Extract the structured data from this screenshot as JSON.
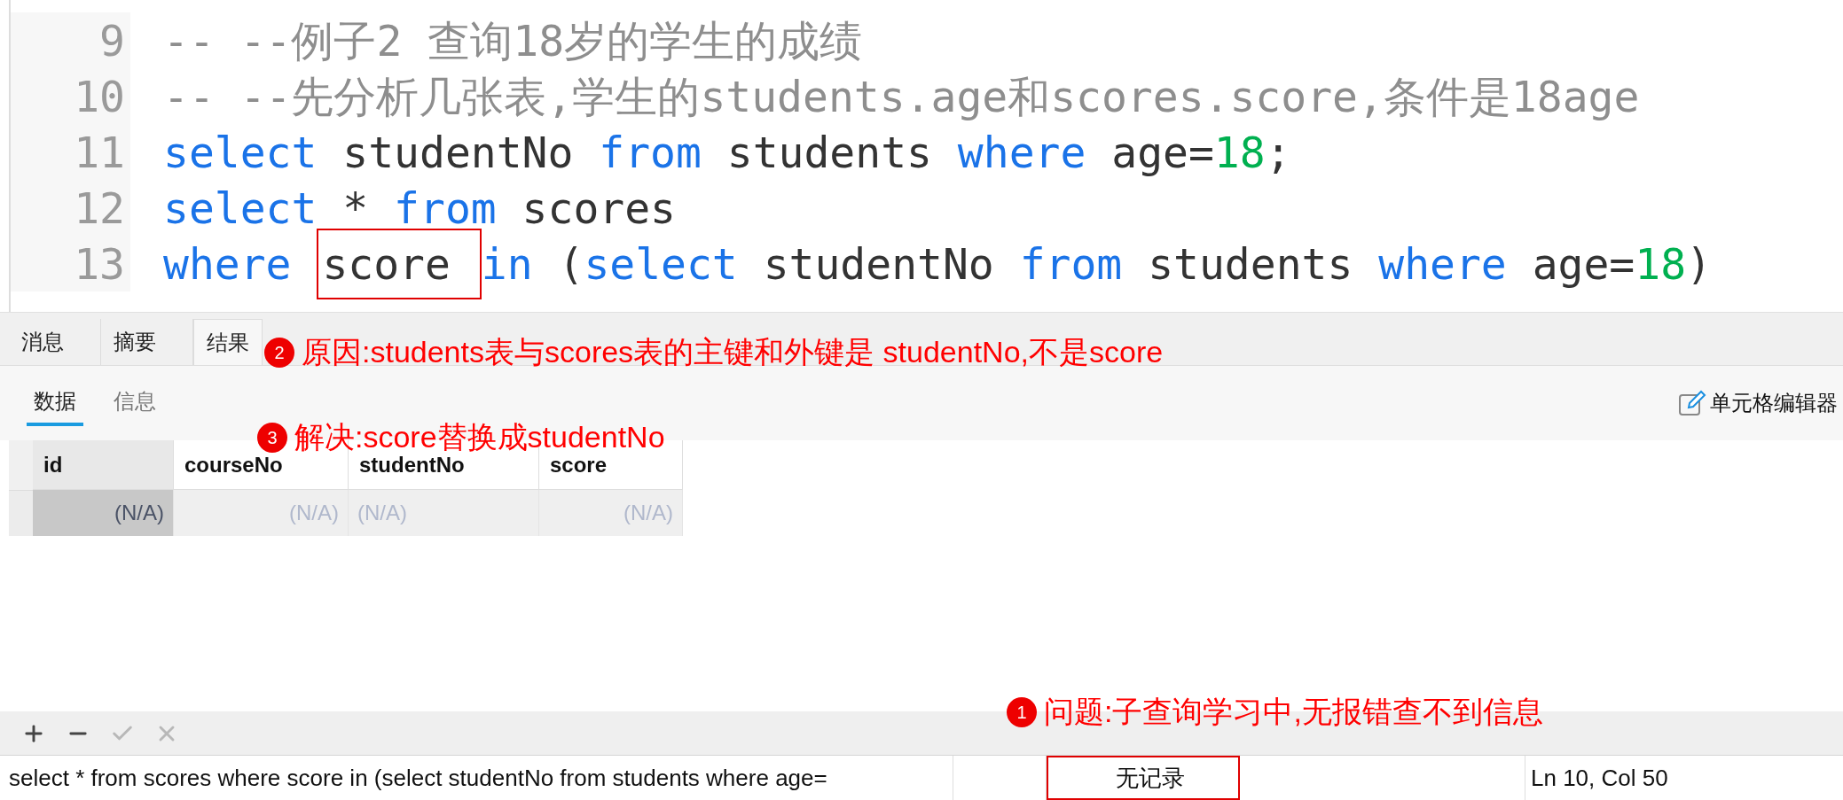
{
  "editor": {
    "lines": [
      {
        "number": "9",
        "tokens": [
          {
            "text": "-- --例子2 查询18岁的学生的成绩",
            "kind": "comment"
          }
        ]
      },
      {
        "number": "10",
        "tokens": [
          {
            "text": "-- --先分析几张表,学生的students.age和scores.score,条件是18age",
            "kind": "comment"
          }
        ]
      },
      {
        "number": "11",
        "tokens": [
          {
            "text": "select",
            "kind": "keyword"
          },
          {
            "text": " studentNo ",
            "kind": "plain"
          },
          {
            "text": "from",
            "kind": "keyword"
          },
          {
            "text": " students ",
            "kind": "plain"
          },
          {
            "text": "where",
            "kind": "keyword"
          },
          {
            "text": " age=",
            "kind": "plain"
          },
          {
            "text": "18",
            "kind": "number"
          },
          {
            "text": ";",
            "kind": "plain"
          }
        ]
      },
      {
        "number": "12",
        "tokens": [
          {
            "text": "select",
            "kind": "keyword"
          },
          {
            "text": " * ",
            "kind": "plain"
          },
          {
            "text": "from",
            "kind": "keyword"
          },
          {
            "text": " scores",
            "kind": "plain"
          }
        ]
      },
      {
        "number": "13",
        "tokens": [
          {
            "text": "where ",
            "kind": "keyword"
          },
          {
            "text": "score ",
            "kind": "marked"
          },
          {
            "text": "in",
            "kind": "keyword"
          },
          {
            "text": " (",
            "kind": "plain"
          },
          {
            "text": "select",
            "kind": "keyword"
          },
          {
            "text": " studentNo ",
            "kind": "plain"
          },
          {
            "text": "from",
            "kind": "keyword"
          },
          {
            "text": " students ",
            "kind": "plain"
          },
          {
            "text": "where",
            "kind": "keyword"
          },
          {
            "text": " age=",
            "kind": "plain"
          },
          {
            "text": "18",
            "kind": "number"
          },
          {
            "text": ")",
            "kind": "plain"
          }
        ]
      }
    ]
  },
  "result_tabs": [
    {
      "label": "消息",
      "selected": false
    },
    {
      "label": "摘要",
      "selected": false
    },
    {
      "label": "结果",
      "selected": true
    }
  ],
  "sub_tabs": [
    {
      "label": "数据",
      "selected": true
    },
    {
      "label": "信息",
      "selected": false
    }
  ],
  "cell_editor_button": "单元格编辑器",
  "table": {
    "columns": [
      {
        "name": "id",
        "kind": "number",
        "selected": true
      },
      {
        "name": "courseNo",
        "kind": "number",
        "selected": false
      },
      {
        "name": "studentNo",
        "kind": "text",
        "selected": false
      },
      {
        "name": "score",
        "kind": "number",
        "selected": false
      }
    ],
    "rows": [
      {
        "cells": [
          {
            "text": "(N/A)",
            "selected": true
          },
          {
            "text": "(N/A)",
            "selected": false
          },
          {
            "text": "(N/A)",
            "selected": false
          },
          {
            "text": "(N/A)",
            "selected": false
          }
        ]
      }
    ]
  },
  "grid_actions": [
    {
      "kind": "add",
      "disabled": false
    },
    {
      "kind": "remove",
      "disabled": false
    },
    {
      "kind": "apply",
      "disabled": true
    },
    {
      "kind": "cancel",
      "disabled": true
    }
  ],
  "status_bar": {
    "query": "select * from scores where score in (select studentNo from students where age=",
    "record_status": {
      "text": "无记录",
      "boxed": true
    },
    "position": "Ln 10, Col 50"
  },
  "annotations": [
    {
      "number": "2",
      "text": "原因:students表与scores表的主键和外键是 studentNo,不是score"
    },
    {
      "number": "3",
      "text": "解决:score替换成studentNo"
    },
    {
      "number": "1",
      "text": "问题:子查询学习中,无报错查不到信息"
    }
  ]
}
